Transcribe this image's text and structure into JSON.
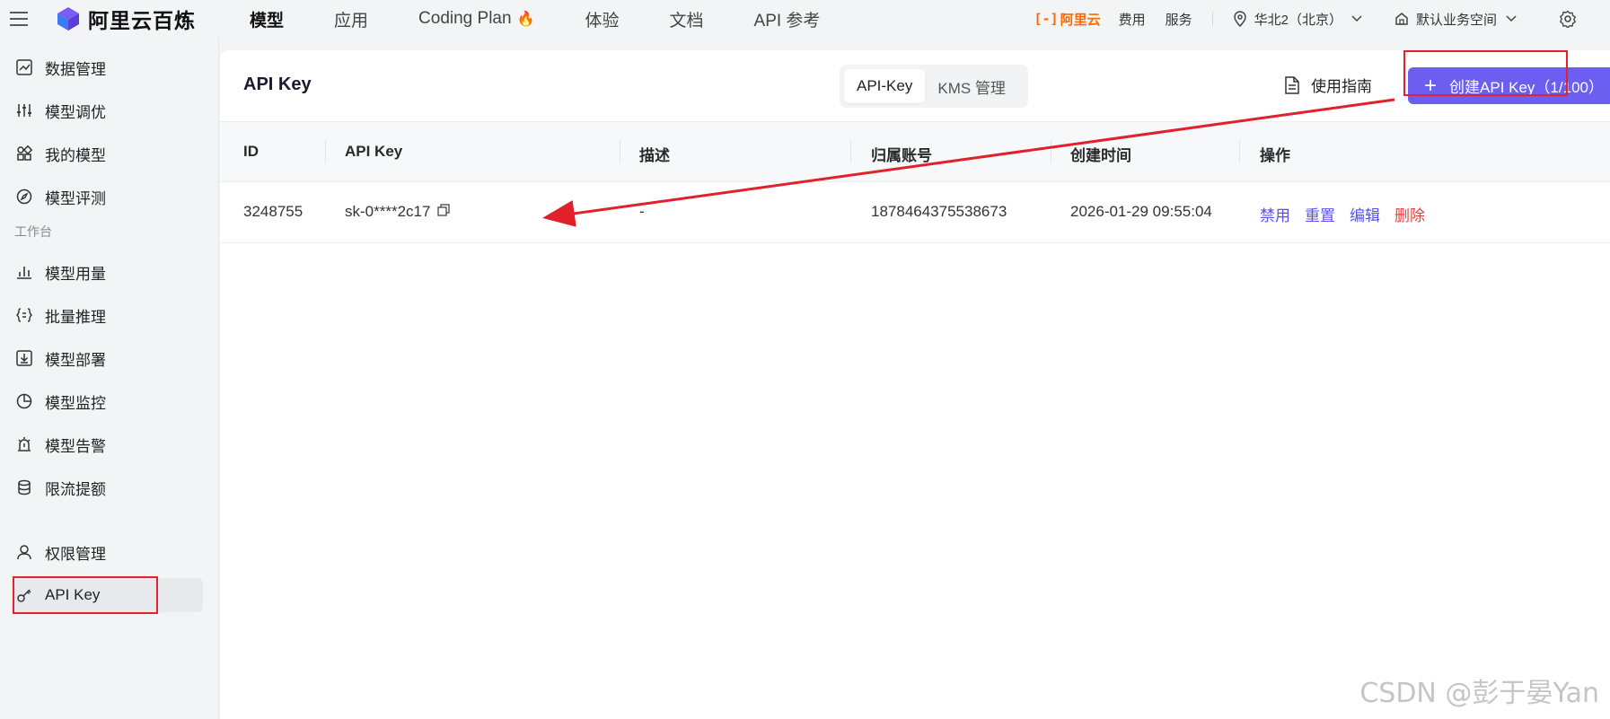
{
  "app": {
    "brand": "阿里云百炼",
    "nav": [
      {
        "label": "模型",
        "active": true
      },
      {
        "label": "应用",
        "active": false
      },
      {
        "label": "Coding Plan",
        "active": false
      },
      {
        "label": "体验",
        "active": false
      },
      {
        "label": "文档",
        "active": false
      },
      {
        "label": "API 参考",
        "active": false
      }
    ],
    "aliyun_logo": "阿里云",
    "aliyun_bracket": "[-]",
    "fees": "费用",
    "service": "服务",
    "region": "华北2（北京）",
    "workspace": "默认业务空间",
    "accent": "#6b5ef0",
    "brand_orange": "#ff6a00"
  },
  "sidebar": {
    "items": [
      {
        "label": "数据管理",
        "icon": "chart-line-icon"
      },
      {
        "label": "模型调优",
        "icon": "sliders-icon"
      },
      {
        "label": "我的模型",
        "icon": "grid-icon"
      },
      {
        "label": "模型评测",
        "icon": "compass-icon"
      }
    ],
    "section": "工作台",
    "items2": [
      {
        "label": "模型用量",
        "icon": "bar-chart-icon"
      },
      {
        "label": "批量推理",
        "icon": "braces-icon"
      },
      {
        "label": "模型部署",
        "icon": "deploy-icon"
      },
      {
        "label": "模型监控",
        "icon": "pie-icon"
      },
      {
        "label": "模型告警",
        "icon": "alarm-icon"
      },
      {
        "label": "限流提额",
        "icon": "database-icon"
      }
    ],
    "items3": [
      {
        "label": "权限管理",
        "icon": "user-icon"
      },
      {
        "label": "API Key",
        "icon": "key-icon",
        "active": true
      }
    ]
  },
  "page": {
    "title": "API Key",
    "tabs": [
      {
        "label": "API-Key",
        "active": true
      },
      {
        "label": "KMS 管理",
        "active": false
      }
    ],
    "guide": "使用指南",
    "create_button": "创建API Key（1/100）",
    "table": {
      "headers": [
        "ID",
        "API Key",
        "描述",
        "归属账号",
        "创建时间",
        "操作"
      ],
      "rows": [
        {
          "id": "3248755",
          "api_key": "sk-0****2c17",
          "desc": "-",
          "account": "1878464375538673",
          "created": "2026-01-29 09:55:04",
          "actions": [
            "禁用",
            "重置",
            "编辑",
            "删除"
          ]
        }
      ]
    }
  },
  "watermark": "CSDN @彭于晏Yan"
}
